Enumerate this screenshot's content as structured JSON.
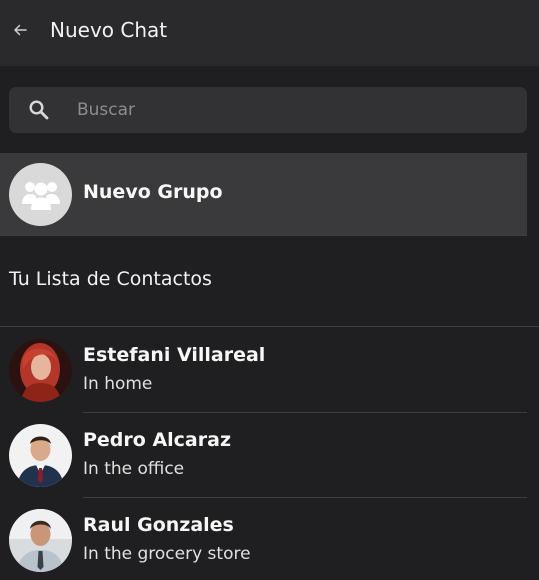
{
  "header": {
    "title": "Nuevo Chat",
    "back_icon": "arrow-left-icon"
  },
  "search": {
    "placeholder": "Buscar",
    "value": "",
    "icon": "search-icon"
  },
  "new_group": {
    "label": "Nuevo Grupo",
    "icon": "group-icon"
  },
  "contacts_section": {
    "title": "Tu Lista de Contactos"
  },
  "contacts": [
    {
      "name": "Estefani Villareal",
      "status": "In home"
    },
    {
      "name": "Pedro Alcaraz",
      "status": "In the office"
    },
    {
      "name": "Raul Gonzales",
      "status": "In the grocery store"
    }
  ],
  "colors": {
    "background": "#1f1f21",
    "header": "#2a2a2c",
    "search_bg": "#323234",
    "highlight_row": "#3a3a3c",
    "text": "#ffffff"
  }
}
